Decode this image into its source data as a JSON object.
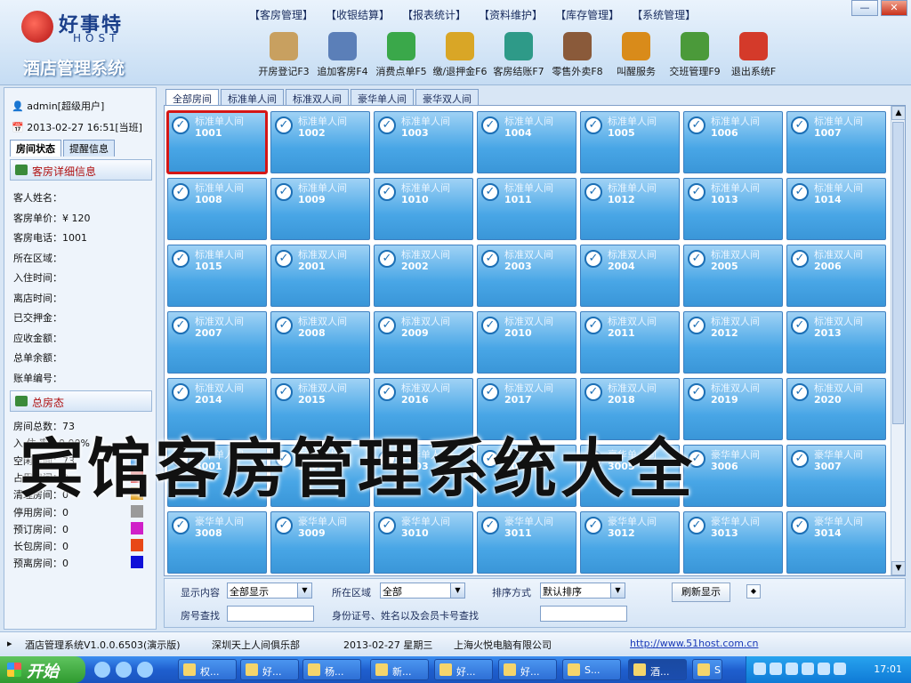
{
  "header": {
    "logo_cn": "好事特",
    "logo_en": "HOST",
    "app_title": "酒店管理系统",
    "menu": [
      "【客房管理】",
      "【收银结算】",
      "【报表统计】",
      "【资料维护】",
      "【库存管理】",
      "【系统管理】"
    ],
    "toolbar": [
      {
        "label": "开房登记F3",
        "icon": "clipboard-icon",
        "color": "#c8a060"
      },
      {
        "label": "追加客房F4",
        "icon": "person-icon",
        "color": "#5b7fb8"
      },
      {
        "label": "消费点单F5",
        "icon": "cart-icon",
        "color": "#3aa84a"
      },
      {
        "label": "缴/退押金F6",
        "icon": "coins-icon",
        "color": "#d9a626"
      },
      {
        "label": "客房结账F7",
        "icon": "yen-icon",
        "color": "#2e9a88"
      },
      {
        "label": "零售外卖F8",
        "icon": "coffee-cup-icon",
        "color": "#8a5a3a"
      },
      {
        "label": "叫醒服务",
        "icon": "alarm-clock-icon",
        "color": "#d98b1a"
      },
      {
        "label": "交班管理F9",
        "icon": "users-icon",
        "color": "#4b9a3a"
      },
      {
        "label": "退出系统F",
        "icon": "exit-icon",
        "color": "#d43a2a"
      }
    ]
  },
  "left": {
    "user": "admin[超级用户]",
    "datetime": "2013-02-27 16:51[当班]",
    "tabs": [
      "房间状态",
      "提醒信息"
    ],
    "detail_title": "客房详细信息",
    "detail_rows": [
      "客人姓名：",
      "客房单价：¥ 120",
      "客房电话：1001",
      "所在区域：",
      "入住时间：",
      "离店时间：",
      "已交押金：",
      "应收金额：",
      "总单余额：",
      "账单编号："
    ],
    "status_title": "总房态",
    "status_rows": [
      {
        "label": "房间总数：73",
        "color": ""
      },
      {
        "label": "入 住 率：0.00%",
        "color": ""
      },
      {
        "label": "空闲房间：73",
        "color": "#1e88e5"
      },
      {
        "label": "占用房间：0",
        "color": "#d81010"
      },
      {
        "label": "清理房间：0",
        "color": "#e0a020"
      },
      {
        "label": "停用房间：0",
        "color": "#9a9a9a"
      },
      {
        "label": "预订房间：0",
        "color": "#d020c8"
      },
      {
        "label": "长包房间：0",
        "color": "#e84818"
      },
      {
        "label": "预离房间：0",
        "color": "#1010d8"
      }
    ]
  },
  "room_tabs": [
    "全部房间",
    "标准单人间",
    "标准双人间",
    "豪华单人间",
    "豪华双人间"
  ],
  "rooms": [
    {
      "type": "标准单人间",
      "no": "1001"
    },
    {
      "type": "标准单人间",
      "no": "1002"
    },
    {
      "type": "标准单人间",
      "no": "1003"
    },
    {
      "type": "标准单人间",
      "no": "1004"
    },
    {
      "type": "标准单人间",
      "no": "1005"
    },
    {
      "type": "标准单人间",
      "no": "1006"
    },
    {
      "type": "标准单人间",
      "no": "1007"
    },
    {
      "type": "标准单人间",
      "no": "1008"
    },
    {
      "type": "标准单人间",
      "no": "1009"
    },
    {
      "type": "标准单人间",
      "no": "1010"
    },
    {
      "type": "标准单人间",
      "no": "1011"
    },
    {
      "type": "标准单人间",
      "no": "1012"
    },
    {
      "type": "标准单人间",
      "no": "1013"
    },
    {
      "type": "标准单人间",
      "no": "1014"
    },
    {
      "type": "标准单人间",
      "no": "1015"
    },
    {
      "type": "标准双人间",
      "no": "2001"
    },
    {
      "type": "标准双人间",
      "no": "2002"
    },
    {
      "type": "标准双人间",
      "no": "2003"
    },
    {
      "type": "标准双人间",
      "no": "2004"
    },
    {
      "type": "标准双人间",
      "no": "2005"
    },
    {
      "type": "标准双人间",
      "no": "2006"
    },
    {
      "type": "标准双人间",
      "no": "2007"
    },
    {
      "type": "标准双人间",
      "no": "2008"
    },
    {
      "type": "标准双人间",
      "no": "2009"
    },
    {
      "type": "标准双人间",
      "no": "2010"
    },
    {
      "type": "标准双人间",
      "no": "2011"
    },
    {
      "type": "标准双人间",
      "no": "2012"
    },
    {
      "type": "标准双人间",
      "no": "2013"
    },
    {
      "type": "标准双人间",
      "no": "2014"
    },
    {
      "type": "标准双人间",
      "no": "2015"
    },
    {
      "type": "标准双人间",
      "no": "2016"
    },
    {
      "type": "标准双人间",
      "no": "2017"
    },
    {
      "type": "标准双人间",
      "no": "2018"
    },
    {
      "type": "标准双人间",
      "no": "2019"
    },
    {
      "type": "标准双人间",
      "no": "2020"
    },
    {
      "type": "豪华单人间",
      "no": "3001"
    },
    {
      "type": "豪华单人间",
      "no": "3002"
    },
    {
      "type": "豪华单人间",
      "no": "3003"
    },
    {
      "type": "豪华单人间",
      "no": "3004"
    },
    {
      "type": "豪华单人间",
      "no": "3005"
    },
    {
      "type": "豪华单人间",
      "no": "3006"
    },
    {
      "type": "豪华单人间",
      "no": "3007"
    },
    {
      "type": "豪华单人间",
      "no": "3008"
    },
    {
      "type": "豪华单人间",
      "no": "3009"
    },
    {
      "type": "豪华单人间",
      "no": "3010"
    },
    {
      "type": "豪华单人间",
      "no": "3011"
    },
    {
      "type": "豪华单人间",
      "no": "3012"
    },
    {
      "type": "豪华单人间",
      "no": "3013"
    },
    {
      "type": "豪华单人间",
      "no": "3014"
    }
  ],
  "overlay_text": "宾馆客房管理系统大全",
  "filter": {
    "display_label": "显示内容",
    "display_value": "全部显示",
    "area_label": "所在区域",
    "area_value": "全部",
    "sort_label": "排序方式",
    "sort_value": "默认排序",
    "refresh_label": "刷新显示",
    "room_search_label": "房号查找",
    "id_search_label": "身份证号、姓名以及会员卡号查找"
  },
  "statusbar": {
    "version": "酒店管理系统V1.0.0.6503(演示版)",
    "client": "深圳天上人间俱乐部",
    "date": "2013-02-27  星期三",
    "company": "上海火悦电脑有限公司",
    "url": "http://www.51host.com.cn"
  },
  "taskbar": {
    "start": "开始",
    "tasks": [
      "权...",
      "好...",
      "杨...",
      "新...",
      "好...",
      "好...",
      "S...",
      "酒...",
      "S"
    ],
    "clock": "17:01"
  }
}
